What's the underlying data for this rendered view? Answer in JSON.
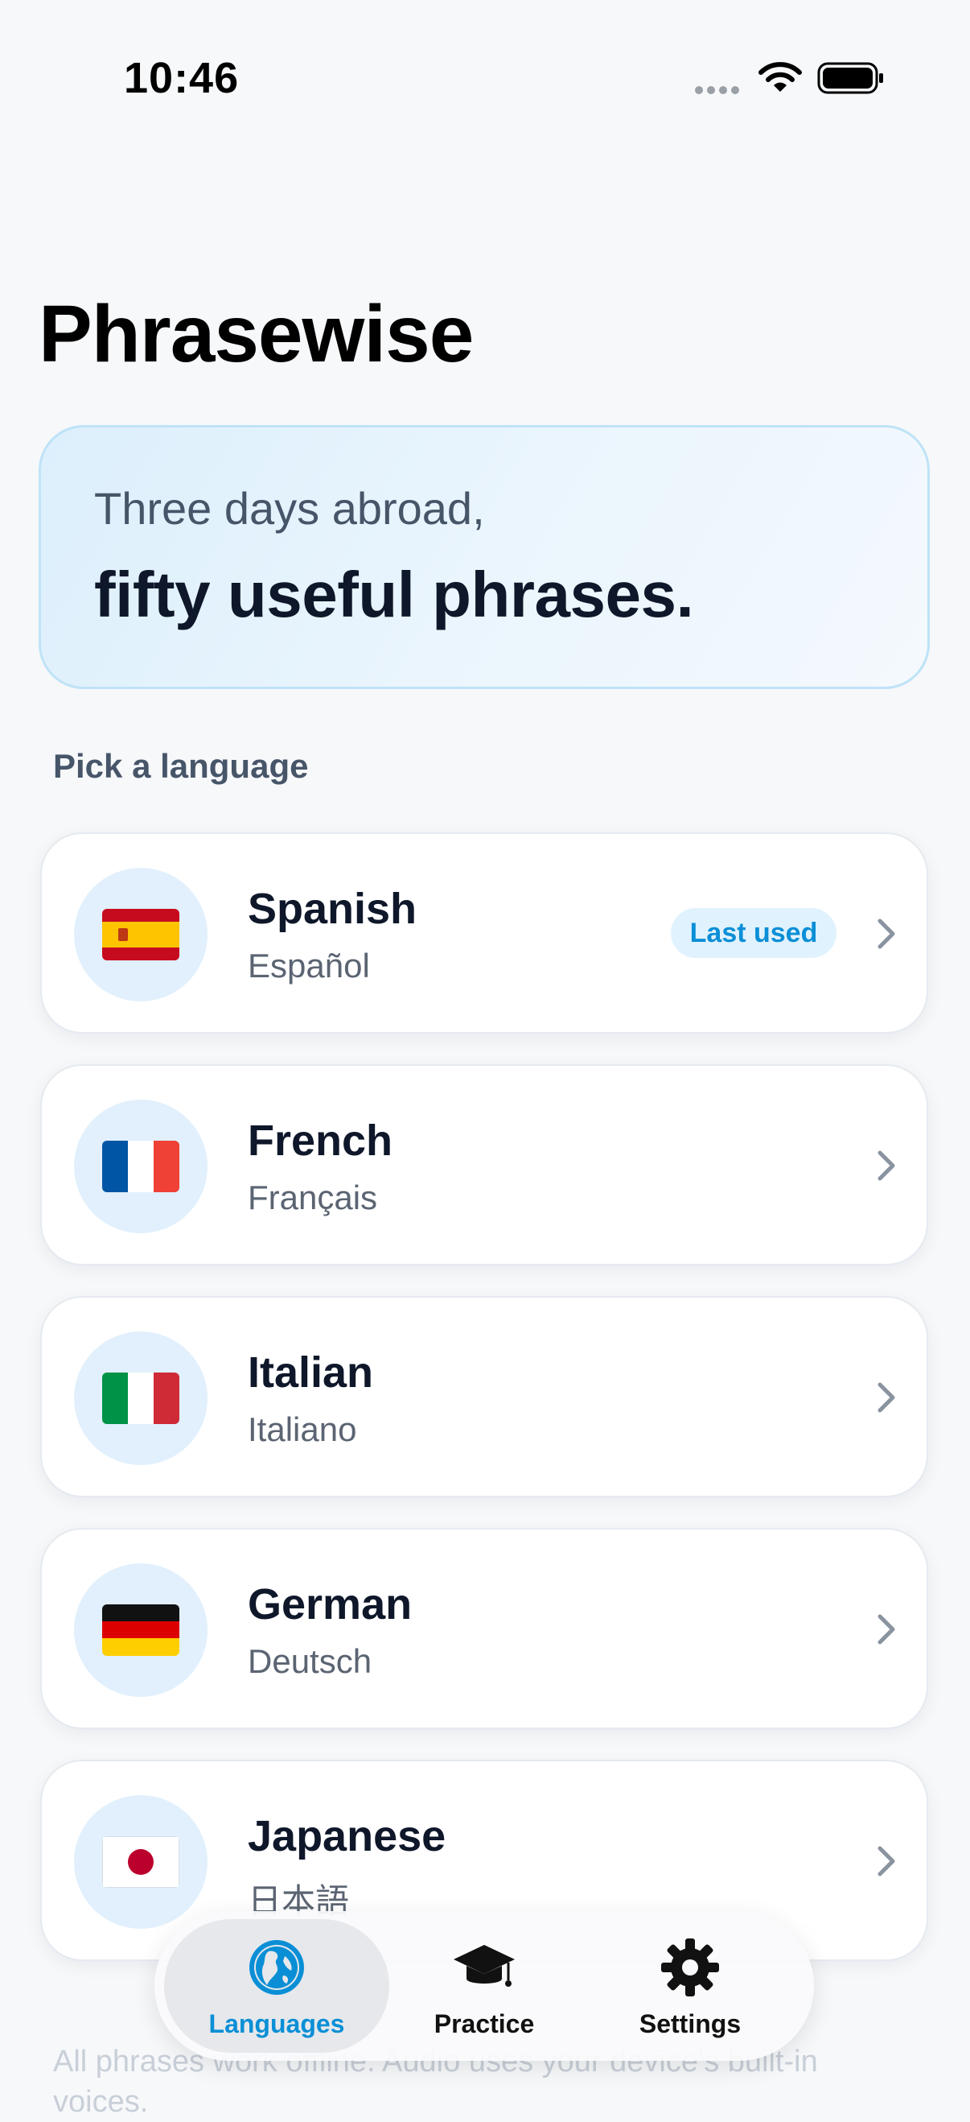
{
  "status_bar": {
    "time": "10:46"
  },
  "app": {
    "title": "Phrasewise"
  },
  "hero": {
    "line1": "Three days abroad,",
    "line2": "fifty useful phrases."
  },
  "section": {
    "label": "Pick a language"
  },
  "languages": [
    {
      "name": "Spanish",
      "native": "Español",
      "flag": "spain-flag",
      "badge": "Last used"
    },
    {
      "name": "French",
      "native": "Français",
      "flag": "france-flag"
    },
    {
      "name": "Italian",
      "native": "Italiano",
      "flag": "italy-flag"
    },
    {
      "name": "German",
      "native": "Deutsch",
      "flag": "germany-flag"
    },
    {
      "name": "Japanese",
      "native": "日本語",
      "flag": "japan-flag"
    }
  ],
  "footer": {
    "note": "All phrases work offline. Audio uses your device's built-in voices."
  },
  "tabs": [
    {
      "label": "Languages",
      "icon": "globe-icon",
      "active": true
    },
    {
      "label": "Practice",
      "icon": "graduation-cap-icon",
      "active": false
    },
    {
      "label": "Settings",
      "icon": "gear-icon",
      "active": false
    }
  ],
  "colors": {
    "accent": "#0A8FD6",
    "background": "#F6F8FA",
    "hero_border": "#BFE3F7",
    "flag_circle": "#E1F0FC",
    "badge_bg": "#E0F2FE"
  }
}
